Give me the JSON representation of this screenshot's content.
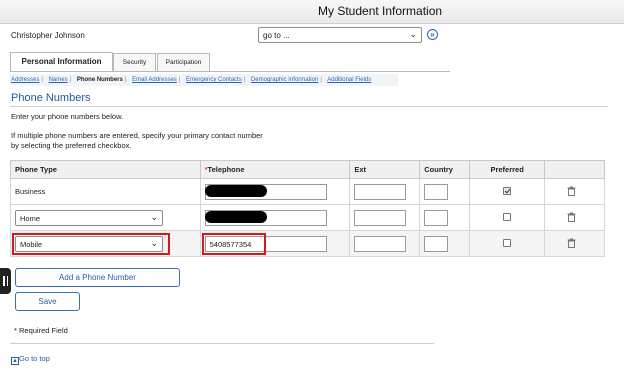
{
  "header": {
    "title": "My Student Information"
  },
  "user": {
    "name": "Christopher Johnson"
  },
  "goto": {
    "value": "go to ..."
  },
  "tabs": [
    {
      "label": "Personal Information",
      "active": true
    },
    {
      "label": "Security",
      "active": false
    },
    {
      "label": "Participation",
      "active": false
    }
  ],
  "subnav": [
    {
      "label": "Addresses",
      "current": false
    },
    {
      "label": "Names",
      "current": false
    },
    {
      "label": "Phone Numbers",
      "current": true
    },
    {
      "label": "Email Addresses",
      "current": false
    },
    {
      "label": "Emergency Contacts",
      "current": false
    },
    {
      "label": "Demographic Information",
      "current": false
    },
    {
      "label": "Additional Fields",
      "current": false
    }
  ],
  "section": {
    "title": "Phone Numbers",
    "instruction": "Enter your phone numbers below.",
    "multi_line1": "If multiple phone numbers are entered, specify your primary contact number",
    "multi_line2": "by selecting the preferred checkbox."
  },
  "table": {
    "headers": {
      "type": "Phone Type",
      "required_mark": "*",
      "telephone": "Telephone",
      "ext": "Ext",
      "country": "Country",
      "preferred": "Preferred"
    },
    "rows": [
      {
        "type": "Business",
        "type_editable": false,
        "telephone": "",
        "redacted": true,
        "ext": "",
        "country": "",
        "preferred": true
      },
      {
        "type": "Home",
        "type_editable": true,
        "telephone": "",
        "redacted": true,
        "ext": "",
        "country": "",
        "preferred": false
      },
      {
        "type": "Mobile",
        "type_editable": true,
        "telephone": "5408577354",
        "redacted": false,
        "ext": "",
        "country": "",
        "preferred": false
      }
    ]
  },
  "buttons": {
    "add_phone": "Add a Phone Number",
    "save": "Save"
  },
  "footer": {
    "required_note": "* Required Field",
    "go_to_top": "Go to top"
  },
  "colors": {
    "link": "#2a64b8",
    "highlight": "#d01b1b",
    "title": "#1f5aa0"
  }
}
